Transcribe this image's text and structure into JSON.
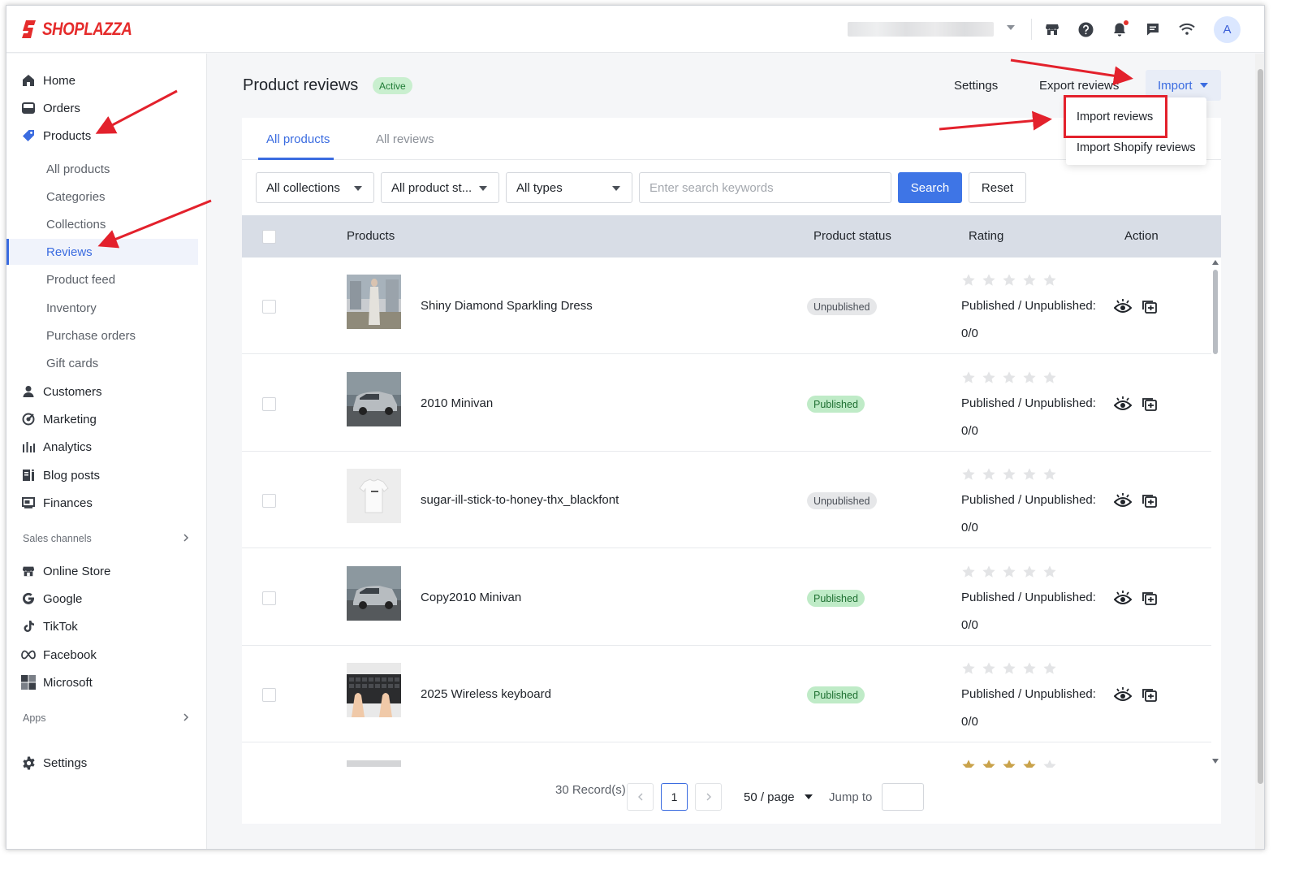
{
  "brand": {
    "name": "SHOPLAZZA",
    "color": "#e52b2b"
  },
  "topbar": {
    "icons": [
      "store-icon",
      "help-icon",
      "bell-icon",
      "message-icon",
      "wifi-icon"
    ],
    "avatar_initial": "A"
  },
  "sidebar": {
    "items": [
      {
        "label": "Home",
        "icon": "home-icon"
      },
      {
        "label": "Orders",
        "icon": "orders-icon"
      },
      {
        "label": "Products",
        "icon": "tag-icon"
      }
    ],
    "product_subitems": [
      "All products",
      "Categories",
      "Collections",
      "Reviews",
      "Product feed",
      "Inventory",
      "Purchase orders",
      "Gift cards"
    ],
    "active_subitem": "Reviews",
    "more_items": [
      {
        "label": "Customers",
        "icon": "person-icon"
      },
      {
        "label": "Marketing",
        "icon": "marketing-icon"
      },
      {
        "label": "Analytics",
        "icon": "analytics-icon"
      },
      {
        "label": "Blog posts",
        "icon": "blog-icon"
      },
      {
        "label": "Finances",
        "icon": "finances-icon"
      }
    ],
    "sales_channels_label": "Sales channels",
    "channels": [
      {
        "label": "Online Store",
        "icon": "store-icon"
      },
      {
        "label": "Google",
        "icon": "google-icon"
      },
      {
        "label": "TikTok",
        "icon": "tiktok-icon"
      },
      {
        "label": "Facebook",
        "icon": "meta-icon"
      },
      {
        "label": "Microsoft",
        "icon": "microsoft-icon"
      }
    ],
    "apps_label": "Apps",
    "settings_label": "Settings"
  },
  "header": {
    "title": "Product reviews",
    "badge": "Active",
    "settings_label": "Settings",
    "export_label": "Export reviews",
    "import_label": "Import"
  },
  "import_menu": {
    "options": [
      "Import reviews",
      "Import Shopify reviews"
    ],
    "highlighted": "Import reviews"
  },
  "tabs": [
    {
      "label": "All products",
      "active": true
    },
    {
      "label": "All reviews",
      "active": false
    }
  ],
  "filters": {
    "collections": "All collections",
    "status": "All product st...",
    "types": "All types",
    "search_placeholder": "Enter search keywords",
    "search_label": "Search",
    "reset_label": "Reset"
  },
  "table": {
    "columns": [
      "Products",
      "Product status",
      "Rating",
      "Action"
    ],
    "rows": [
      {
        "name": "Shiny Diamond Sparkling Dress",
        "status": "Unpublished",
        "rating_text": "Published / Unpublished:",
        "count": "0/0",
        "stars": 0,
        "thumb": "dress"
      },
      {
        "name": "2010 Minivan",
        "status": "Published",
        "rating_text": "Published / Unpublished:",
        "count": "0/0",
        "stars": 0,
        "thumb": "van"
      },
      {
        "name": "sugar-ill-stick-to-honey-thx_blackfont",
        "status": "Unpublished",
        "rating_text": "Published / Unpublished:",
        "count": "0/0",
        "stars": 0,
        "thumb": "tshirt"
      },
      {
        "name": "Copy2010 Minivan",
        "status": "Published",
        "rating_text": "Published / Unpublished:",
        "count": "0/0",
        "stars": 0,
        "thumb": "van"
      },
      {
        "name": "2025 Wireless keyboard",
        "status": "Published",
        "rating_text": "Published / Unpublished:",
        "count": "0/0",
        "stars": 0,
        "thumb": "keyboard"
      }
    ],
    "partial_row_stars": 4
  },
  "pagination": {
    "records": "30 Record(s)",
    "current_page": "1",
    "page_size": "50 / page",
    "jump_label": "Jump to"
  },
  "colors": {
    "accent": "#3b6ce0",
    "annotation": "#e3212c"
  }
}
